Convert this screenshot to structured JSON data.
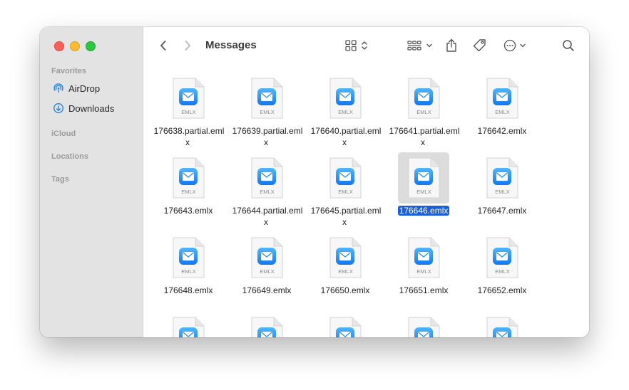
{
  "window": {
    "title": "Messages"
  },
  "sidebar": {
    "favorites_label": "Favorites",
    "items": [
      {
        "label": "AirDrop",
        "icon": "airdrop-icon"
      },
      {
        "label": "Downloads",
        "icon": "downloads-icon"
      }
    ],
    "icloud_label": "iCloud",
    "locations_label": "Locations",
    "tags_label": "Tags"
  },
  "toolbar": {
    "icons": [
      "back-icon",
      "forward-icon",
      "grid-view-icon",
      "group-by-icon",
      "share-icon",
      "tag-icon",
      "more-actions-icon",
      "search-icon"
    ]
  },
  "file_badge": "EMLX",
  "files": [
    {
      "name": "176638.partial.emlx"
    },
    {
      "name": "176639.partial.emlx"
    },
    {
      "name": "176640.partial.emlx"
    },
    {
      "name": "176641.partial.emlx"
    },
    {
      "name": "176642.emlx"
    },
    {
      "name": "176643.emlx"
    },
    {
      "name": "176644.partial.emlx"
    },
    {
      "name": "176645.partial.emlx"
    },
    {
      "name": "176646.emlx",
      "selected": true
    },
    {
      "name": "176647.emlx"
    },
    {
      "name": "176648.emlx"
    },
    {
      "name": "176649.emlx"
    },
    {
      "name": "176650.emlx"
    },
    {
      "name": "176651.emlx"
    },
    {
      "name": "176652.emlx"
    }
  ],
  "colors": {
    "selection": "#1a5fd6",
    "mail_gradient_top": "#4fb6ff",
    "mail_gradient_bottom": "#1477f0"
  }
}
